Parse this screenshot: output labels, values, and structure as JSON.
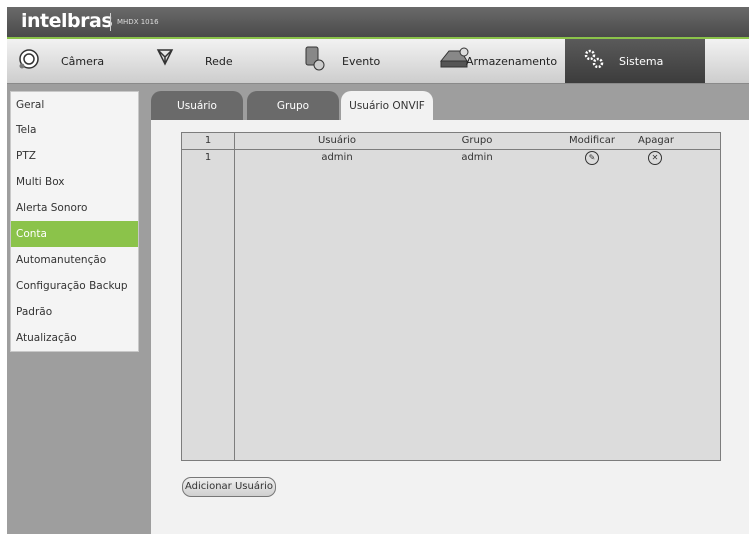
{
  "header": {
    "logo": "intelbras",
    "model": "MHDX 1016"
  },
  "nav": [
    {
      "label": "Câmera",
      "icon": "camera-icon"
    },
    {
      "label": "Rede",
      "icon": "network-icon"
    },
    {
      "label": "Evento",
      "icon": "event-icon"
    },
    {
      "label": "Armazenamento",
      "icon": "storage-icon"
    },
    {
      "label": "Sistema",
      "icon": "gear-icon",
      "active": true
    }
  ],
  "sidebar": [
    {
      "label": "Geral"
    },
    {
      "label": "Tela"
    },
    {
      "label": "PTZ"
    },
    {
      "label": "Multi Box"
    },
    {
      "label": "Alerta Sonoro"
    },
    {
      "label": "Conta",
      "active": true
    },
    {
      "label": "Automanutenção"
    },
    {
      "label": "Configuração Backup"
    },
    {
      "label": "Padrão"
    },
    {
      "label": "Atualização"
    }
  ],
  "tabs": [
    {
      "label": "Usuário"
    },
    {
      "label": "Grupo"
    },
    {
      "label": "Usuário ONVIF",
      "active": true
    }
  ],
  "table": {
    "headers": [
      "1",
      "Usuário",
      "Grupo",
      "Modificar",
      "Apagar"
    ],
    "rows": [
      {
        "index": "1",
        "user": "admin",
        "group": "admin"
      }
    ]
  },
  "actions": {
    "add_user": "Adicionar Usuário"
  },
  "colors": {
    "accent": "#8bc34a",
    "titlebar": "#4a4a4a",
    "panel": "#f2f2f2"
  }
}
